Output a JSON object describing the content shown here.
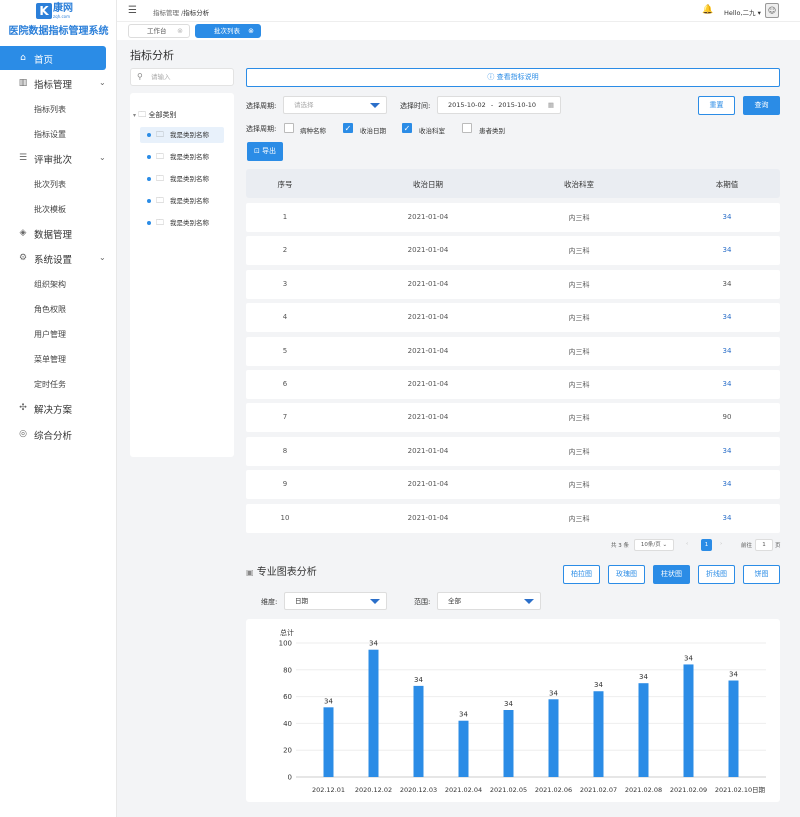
{
  "app": {
    "logo_mark": "K",
    "logo_name": "康网",
    "logo_sub": "zqh.com",
    "system_title": "医院数据指标管理系统"
  },
  "sidebar": {
    "items": [
      {
        "label": "首页",
        "icon": "home-icon"
      },
      {
        "label": "指标管理",
        "icon": "chart-icon",
        "children": [
          "指标列表",
          "指标设置"
        ]
      },
      {
        "label": "评审批次",
        "icon": "list-icon",
        "children": [
          "批次列表",
          "批次模板"
        ]
      },
      {
        "label": "数据管理",
        "icon": "cube-icon"
      },
      {
        "label": "系统设置",
        "icon": "gear-icon",
        "children": [
          "组织架构",
          "角色权限",
          "用户管理",
          "菜单管理",
          "定时任务"
        ]
      },
      {
        "label": "解决方案",
        "icon": "solution-icon"
      },
      {
        "label": "综合分析",
        "icon": "analysis-icon"
      }
    ]
  },
  "header": {
    "breadcrumb_parent": "指标管理",
    "breadcrumb_sep": " /",
    "breadcrumb_current": "指标分析",
    "greeting": "Hello,二九",
    "user_caret": "▾"
  },
  "tabs": [
    {
      "label": "工作台",
      "active": false
    },
    {
      "label": "批次列表",
      "active": true
    }
  ],
  "page": {
    "title": "指标分析",
    "search_placeholder": "请输入",
    "explain_button": "查看指标说明"
  },
  "tree": {
    "root": "全部类别",
    "items": [
      "我是类别名称",
      "我是类别名称",
      "我是类别名称",
      "我是类别名称",
      "我是类别名称"
    ]
  },
  "filters": {
    "period_label": "选择周期:",
    "period_placeholder": "请选择",
    "time_label": "选择时间:",
    "date_start": "2015-10-02",
    "date_sep": "-",
    "date_end": "2015-10-10",
    "reset": "重置",
    "query": "查询",
    "dimension_label": "选择周期:",
    "checkboxes": [
      {
        "label": "病种名称",
        "checked": false
      },
      {
        "label": "收治日期",
        "checked": true
      },
      {
        "label": "收治科室",
        "checked": true
      },
      {
        "label": "患者类别",
        "checked": false
      }
    ],
    "export": "导出"
  },
  "table": {
    "headers": [
      "序号",
      "收治日期",
      "收治科室",
      "本期值"
    ],
    "rows": [
      [
        "1",
        "2021-01-04",
        "内三科",
        "34"
      ],
      [
        "2",
        "2021-01-04",
        "内三科",
        "34"
      ],
      [
        "3",
        "2021-01-04",
        "内三科",
        "34"
      ],
      [
        "4",
        "2021-01-04",
        "内三科",
        "34"
      ],
      [
        "5",
        "2021-01-04",
        "内三科",
        "34"
      ],
      [
        "6",
        "2021-01-04",
        "内三科",
        "34"
      ],
      [
        "7",
        "2021-01-04",
        "内三科",
        "90"
      ],
      [
        "8",
        "2021-01-04",
        "内三科",
        "34"
      ],
      [
        "9",
        "2021-01-04",
        "内三科",
        "34"
      ],
      [
        "10",
        "2021-01-04",
        "内三科",
        "34"
      ]
    ],
    "blue_values": [
      true,
      true,
      false,
      true,
      true,
      true,
      false,
      true,
      true,
      true
    ]
  },
  "pagination": {
    "total": "共 3 条",
    "page_size": "10条/页",
    "prev": "‹",
    "current": "1",
    "next": "›",
    "goto_label": "前往",
    "goto_value": "1",
    "page_unit": "页"
  },
  "chart_section": {
    "title": "专业图表分析",
    "buttons": [
      {
        "label": "柏拉图",
        "active": false
      },
      {
        "label": "玫瑰图",
        "active": false
      },
      {
        "label": "柱状图",
        "active": true
      },
      {
        "label": "折线图",
        "active": false
      },
      {
        "label": "饼图",
        "active": false
      }
    ],
    "dimension_label": "维度:",
    "dimension_value": "日期",
    "range_label": "范围:",
    "range_value": "全部"
  },
  "chart_data": {
    "type": "bar",
    "ylabel": "总计",
    "xlabel": "日期",
    "ylim": [
      0,
      100
    ],
    "yticks": [
      0,
      20,
      40,
      60,
      80,
      100
    ],
    "categories": [
      "202.12.01",
      "2020.12.02",
      "2020.12.03",
      "2021.02.04",
      "2021.02.05",
      "2021.02.06",
      "2021.02.07",
      "2021.02.08",
      "2021.02.09",
      "2021.02.10"
    ],
    "values": [
      52,
      95,
      68,
      42,
      50,
      58,
      64,
      70,
      84,
      72
    ],
    "labels": [
      "34",
      "34",
      "34",
      "34",
      "34",
      "34",
      "34",
      "34",
      "34",
      "34"
    ],
    "grid": true,
    "color": "#2b8ce6"
  }
}
